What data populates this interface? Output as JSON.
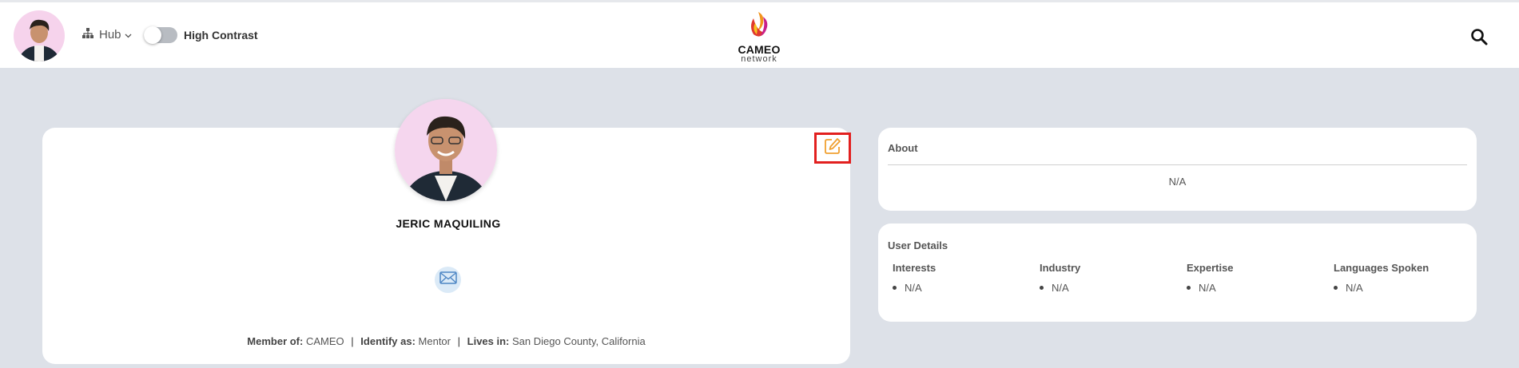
{
  "nav": {
    "hub_label": "Hub",
    "high_contrast_label": "High Contrast",
    "high_contrast_on": false,
    "logo_word": "CAMEO",
    "logo_sub": "network"
  },
  "profile": {
    "name": "JERIC MAQUILING",
    "member_of_label": "Member of:",
    "member_of_value": "CAMEO",
    "identify_label": "Identify as:",
    "identify_value": "Mentor",
    "lives_label": "Lives in:",
    "lives_value": "San Diego County, California",
    "separator": "|"
  },
  "about": {
    "title": "About",
    "value": "N/A"
  },
  "user_details": {
    "title": "User Details",
    "columns": [
      {
        "heading": "Interests",
        "items": [
          "N/A"
        ]
      },
      {
        "heading": "Industry",
        "items": [
          "N/A"
        ]
      },
      {
        "heading": "Expertise",
        "items": [
          "N/A"
        ]
      },
      {
        "heading": "Languages Spoken",
        "items": [
          "N/A"
        ]
      }
    ]
  },
  "colors": {
    "background": "#dde1e8",
    "edit_icon": "#f0a030",
    "edit_highlight": "#e2201f",
    "mail_bg": "#dbeaf7"
  },
  "icons": [
    "hierarchy-icon",
    "chevron-down-icon",
    "search-icon",
    "edit-icon",
    "mail-icon"
  ]
}
